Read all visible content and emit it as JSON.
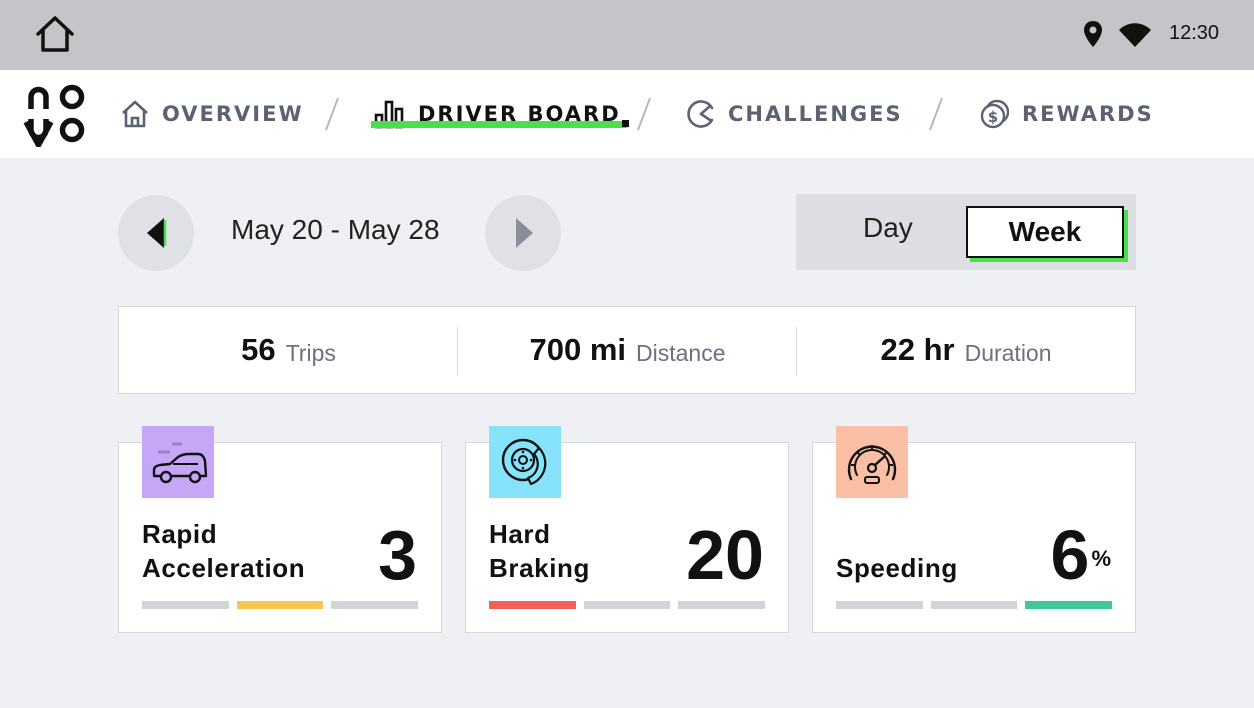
{
  "status_bar": {
    "time": "12:30",
    "icons": [
      "home-icon",
      "location-pin-icon",
      "wifi-icon"
    ]
  },
  "nav": {
    "logo_icon": "brand-logo",
    "tabs": [
      {
        "label": "OVERVIEW",
        "icon": "house-icon",
        "active": false
      },
      {
        "label": "DRIVER BOARD",
        "icon": "bar-chart-icon",
        "active": true
      },
      {
        "label": "CHALLENGES",
        "icon": "gauge-icon",
        "active": false
      },
      {
        "label": "REWARDS",
        "icon": "coin-icon",
        "active": false
      }
    ],
    "active_color": "#4cde4c"
  },
  "date_nav": {
    "range": "May 20 - May 28",
    "prev_icon": "triangle-left-icon",
    "next_icon": "triangle-right-icon"
  },
  "period_toggle": {
    "options": [
      "Day",
      "Week"
    ],
    "selected": "Week"
  },
  "stats": [
    {
      "value": "56",
      "label": "Trips"
    },
    {
      "value": "700 mi",
      "label": "Distance"
    },
    {
      "value": "22 hr",
      "label": "Duration"
    }
  ],
  "cards": [
    {
      "title_line1": "Rapid",
      "title_line2": "Acceleration",
      "value": "3",
      "suffix": "",
      "icon": "car-speed-icon",
      "icon_bg": "#c6a6f6",
      "bars": [
        "#d4d5d9",
        "#f7c552",
        "#d4d5d9"
      ]
    },
    {
      "title_line1": "Hard",
      "title_line2": "Braking",
      "value": "20",
      "suffix": "",
      "icon": "brake-disc-icon",
      "icon_bg": "#86e3fa",
      "bars": [
        "#f35f5a",
        "#d4d5d9",
        "#d4d5d9"
      ]
    },
    {
      "title_line1": "",
      "title_line2": "Speeding",
      "value": "6",
      "suffix": "%",
      "icon": "speedometer-icon",
      "icon_bg": "#fbbfa6",
      "bars": [
        "#d4d5d9",
        "#d4d5d9",
        "#3ec99a"
      ]
    }
  ]
}
